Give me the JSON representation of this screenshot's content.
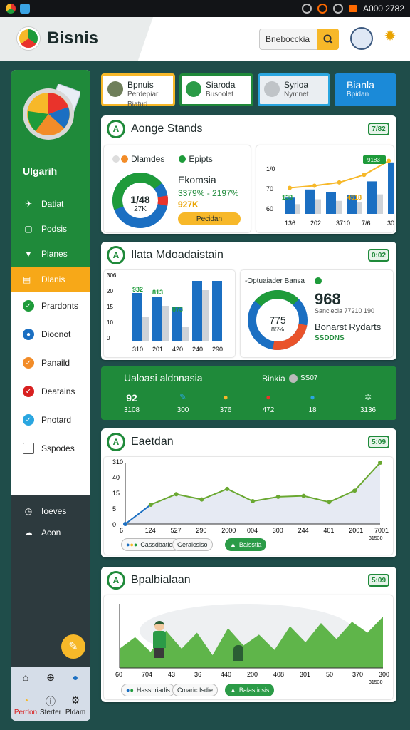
{
  "status": {
    "time": "A000 2782"
  },
  "header": {
    "brand": "Bisnis",
    "search_placeholder": "Bnebocckia"
  },
  "sidebar": {
    "title": "Ulgarih",
    "items": [
      {
        "label": "Datiat"
      },
      {
        "label": "Podsis"
      },
      {
        "label": "Planes"
      }
    ],
    "active": {
      "label": "Dlanis"
    },
    "list2": [
      {
        "label": "Prardonts"
      },
      {
        "label": "Dioonot"
      },
      {
        "label": "Panaild"
      },
      {
        "label": "Deatains"
      },
      {
        "label": "Pnotard"
      },
      {
        "label": "Sspodes"
      }
    ],
    "dark_items": [
      {
        "label": "Ioeves"
      },
      {
        "label": "Acon"
      }
    ],
    "bottom_nav": [
      {
        "label": "Perdon"
      },
      {
        "label": "Sterter"
      },
      {
        "label": "Pldam"
      }
    ]
  },
  "tabs": [
    {
      "label": "Bpnuis",
      "sub": "Perdepiar Biatud"
    },
    {
      "label": "Siaroda",
      "sub": "Busoolet"
    },
    {
      "label": "Syrioa",
      "sub": "Nymnet"
    },
    {
      "label": "Bianla",
      "sub": "Bpidan"
    }
  ],
  "card1": {
    "title": "Aonge Stands",
    "badge": "7/82",
    "legend": [
      "Dlamdes",
      "Epipts"
    ],
    "donut_value": "1/48",
    "donut_sub": "27K",
    "headline": "Ekomsia",
    "stat_line": "3379% - 2197%",
    "stat_sub": "927K",
    "button": "Pecidan",
    "mini_badge": "9183",
    "bar_labels": [
      "136",
      "202",
      "3710",
      "7/6",
      "300"
    ],
    "y_ticks": [
      "1/0",
      "70",
      "60"
    ],
    "bar_tops": [
      "138",
      "4518"
    ],
    "bar_values": [
      30,
      45,
      40,
      35,
      60,
      95
    ],
    "line_values": [
      48,
      52,
      58,
      72,
      98
    ]
  },
  "card2": {
    "title": "Ilata Mdoadaistain",
    "badge": "0:02",
    "y_ticks": [
      "306",
      "20",
      "15",
      "10",
      "0"
    ],
    "x_ticks": [
      "310",
      "201",
      "420",
      "240",
      "290"
    ],
    "data_labels": [
      "932",
      "813",
      "873"
    ],
    "bars_blue": [
      68,
      63,
      48,
      85,
      85
    ],
    "bars_gray": [
      34,
      50,
      21,
      72,
      0
    ],
    "panel_label": "-Optuaiader Bansa",
    "donut_center": "775",
    "donut_center_sub": "85%",
    "big": "968",
    "sub": "Sanclecia 77210 190",
    "caption": "Bonarst Rydarts",
    "caption_sub": "SSDDNS"
  },
  "strip": {
    "title": "Ualoasi aldonasia",
    "right_label": "Binkia",
    "right_value": "SS07",
    "values": [
      {
        "big": "92",
        "small": "3108"
      },
      {
        "big": "",
        "small": "300"
      },
      {
        "big": "",
        "small": "376"
      },
      {
        "big": "",
        "small": "472"
      },
      {
        "big": "",
        "small": "18"
      },
      {
        "big": "",
        "small": "3136"
      }
    ]
  },
  "card3": {
    "title": "Eaetdan",
    "badge": "5:09",
    "y_ticks": [
      "310",
      "40",
      "15",
      "5",
      "0"
    ],
    "x_ticks": [
      "6",
      "124",
      "527",
      "290",
      "2000",
      "004",
      "300",
      "244",
      "401",
      "2001",
      "7001"
    ],
    "x_note": "31530",
    "x_note2": "0/0",
    "chips": [
      "Cassdbatios",
      "Geralcsiso",
      "Baisstia"
    ],
    "values": [
      0,
      22,
      34,
      28,
      40,
      26,
      31,
      32,
      25,
      38,
      70
    ]
  },
  "card4": {
    "title": "Bpalbialaan",
    "badge": "5:09",
    "x_ticks": [
      "60",
      "704",
      "43",
      "36",
      "440",
      "200",
      "408",
      "301",
      "50",
      "370",
      "300"
    ],
    "x_note": "31530",
    "chips": [
      "Hassbriadis",
      "Cmaric Isdie",
      "Balasticsis"
    ],
    "values": [
      30,
      48,
      25,
      58,
      30,
      55,
      20,
      62,
      35,
      52,
      28,
      65,
      40,
      70,
      45,
      72,
      55,
      80
    ]
  },
  "colors": {
    "green": "#1f8a3a",
    "orange": "#f7b829",
    "blue": "#1b6fc2",
    "red": "#e9332b"
  }
}
